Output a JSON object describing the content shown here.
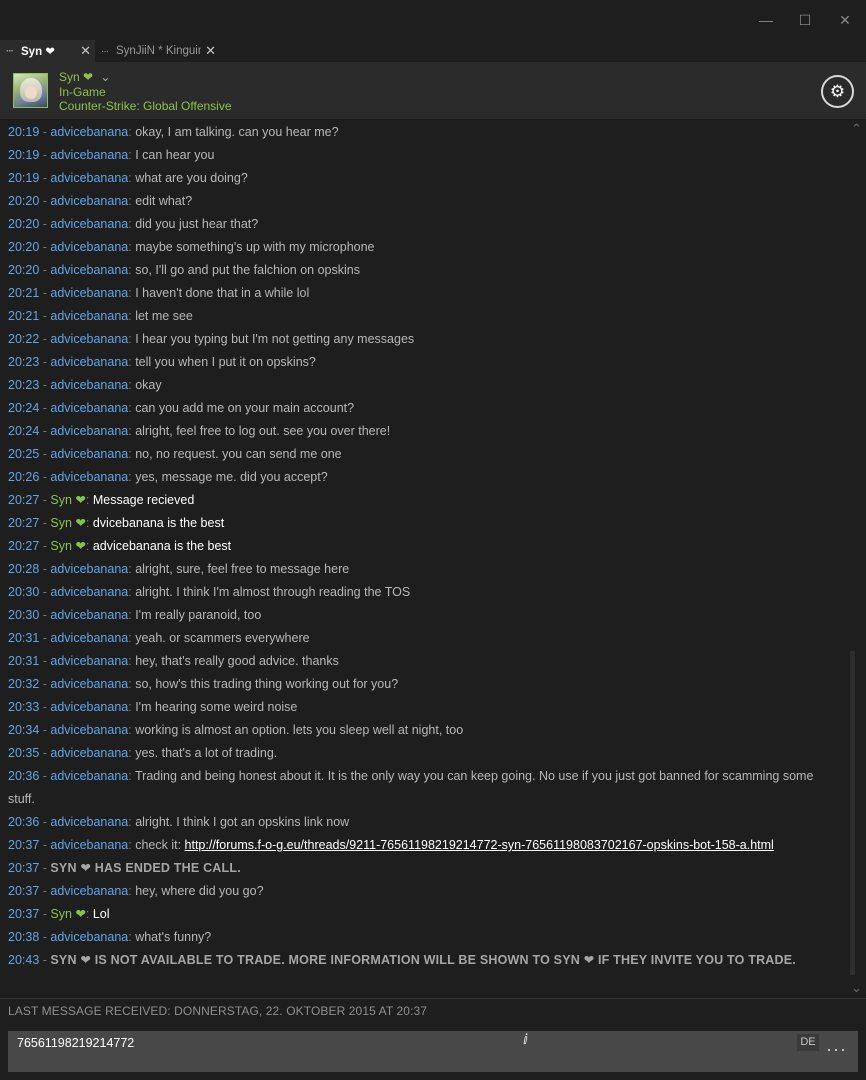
{
  "window": {
    "minimize_icon": "minimize-icon",
    "maximize_icon": "maximize-icon",
    "close_icon": "close-icon"
  },
  "tabs": [
    {
      "label": "Syn ❤",
      "active": true,
      "grip": "···",
      "close": "✕"
    },
    {
      "label": "SynJiiN * Kinguin",
      "active": false,
      "grip": "···",
      "close": "✕"
    }
  ],
  "header": {
    "name": "Syn ❤",
    "dropdown": "⌄",
    "status": "In-Game",
    "game": "Counter-Strike: Global Offensive",
    "settings_icon": "⚙"
  },
  "messages": [
    {
      "time": "20:19",
      "user": "advicebanana",
      "text": "okay, I am talking. can you hear me?"
    },
    {
      "time": "20:19",
      "user": "advicebanana",
      "text": "I can hear you"
    },
    {
      "time": "20:19",
      "user": "advicebanana",
      "text": "what are you doing?"
    },
    {
      "time": "20:20",
      "user": "advicebanana",
      "text": "edit what?"
    },
    {
      "time": "20:20",
      "user": "advicebanana",
      "text": "did you just hear that?"
    },
    {
      "time": "20:20",
      "user": "advicebanana",
      "text": "maybe something's up with my microphone"
    },
    {
      "time": "20:20",
      "user": "advicebanana",
      "text": "so, I'll go and put the falchion on opskins"
    },
    {
      "time": "20:21",
      "user": "advicebanana",
      "text": "I haven't done that in a while lol"
    },
    {
      "time": "20:21",
      "user": "advicebanana",
      "text": "let me see"
    },
    {
      "time": "20:22",
      "user": "advicebanana",
      "text": "I hear you typing but I'm not getting any messages"
    },
    {
      "time": "20:23",
      "user": "advicebanana",
      "text": "tell you when I put it on opskins?"
    },
    {
      "time": "20:23",
      "user": "advicebanana",
      "text": "okay"
    },
    {
      "time": "20:24",
      "user": "advicebanana",
      "text": "can you add me on your main account?"
    },
    {
      "time": "20:24",
      "user": "advicebanana",
      "text": "alright, feel free to log out. see you over there!"
    },
    {
      "time": "20:25",
      "user": "advicebanana",
      "text": "no, no request. you can send me one"
    },
    {
      "time": "20:26",
      "user": "advicebanana",
      "text": "yes, message me. did you accept?"
    },
    {
      "time": "20:27",
      "user": "Syn ❤",
      "self": true,
      "text": "Message recieved"
    },
    {
      "time": "20:27",
      "user": "Syn ❤",
      "self": true,
      "text": "dvicebanana is the best"
    },
    {
      "time": "20:27",
      "user": "Syn ❤",
      "self": true,
      "text": "advicebanana is the best"
    },
    {
      "time": "20:28",
      "user": "advicebanana",
      "text": "alright, sure, feel free to message here"
    },
    {
      "time": "20:30",
      "user": "advicebanana",
      "text": "alright. I think I'm almost through reading the TOS"
    },
    {
      "time": "20:30",
      "user": "advicebanana",
      "text": "I'm really paranoid, too"
    },
    {
      "time": "20:31",
      "user": "advicebanana",
      "text": "yeah. or scammers everywhere"
    },
    {
      "time": "20:31",
      "user": "advicebanana",
      "text": "hey, that's really good advice. thanks"
    },
    {
      "time": "20:32",
      "user": "advicebanana",
      "text": "so, how's this trading thing working out for you?"
    },
    {
      "time": "20:33",
      "user": "advicebanana",
      "text": "I'm hearing some weird noise"
    },
    {
      "time": "20:34",
      "user": "advicebanana",
      "text": "working is almost an option. lets you sleep well at night, too"
    },
    {
      "time": "20:35",
      "user": "advicebanana",
      "text": "yes. that's a lot of trading."
    },
    {
      "time": "20:36",
      "user": "advicebanana",
      "text": "Trading and being honest about it. It is the only way you can keep going. No use if you just got banned for scamming some stuff."
    },
    {
      "time": "20:36",
      "user": "advicebanana",
      "text": "alright. I think I got an opskins link now"
    },
    {
      "time": "20:37",
      "user": "advicebanana",
      "text": "check it: ",
      "link": "http://forums.f-o-g.eu/threads/9211-76561198219214772-syn-76561198083702167-opskins-bot-158-a.html"
    },
    {
      "time": "20:37",
      "event": true,
      "text": "SYN ❤ HAS ENDED THE CALL."
    },
    {
      "time": "20:37",
      "user": "advicebanana",
      "text": "hey, where did you go?"
    },
    {
      "time": "20:37",
      "user": "Syn ❤",
      "self": true,
      "text": "Lol"
    },
    {
      "time": "20:38",
      "user": "advicebanana",
      "text": "what's funny?"
    },
    {
      "time": "20:43",
      "event": true,
      "text": "SYN ❤ IS NOT AVAILABLE TO TRADE. MORE INFORMATION WILL BE SHOWN TO SYN ❤ IF THEY INVITE YOU TO TRADE."
    }
  ],
  "footer": {
    "last_message": "LAST MESSAGE RECEIVED: DONNERSTAG, 22. OKTOBER 2015 AT 20:37"
  },
  "input": {
    "value": "76561198219214772",
    "language": "DE",
    "more_icon": "···"
  },
  "scroll": {
    "up_icon": "⌃",
    "down_icon": "⌄"
  }
}
